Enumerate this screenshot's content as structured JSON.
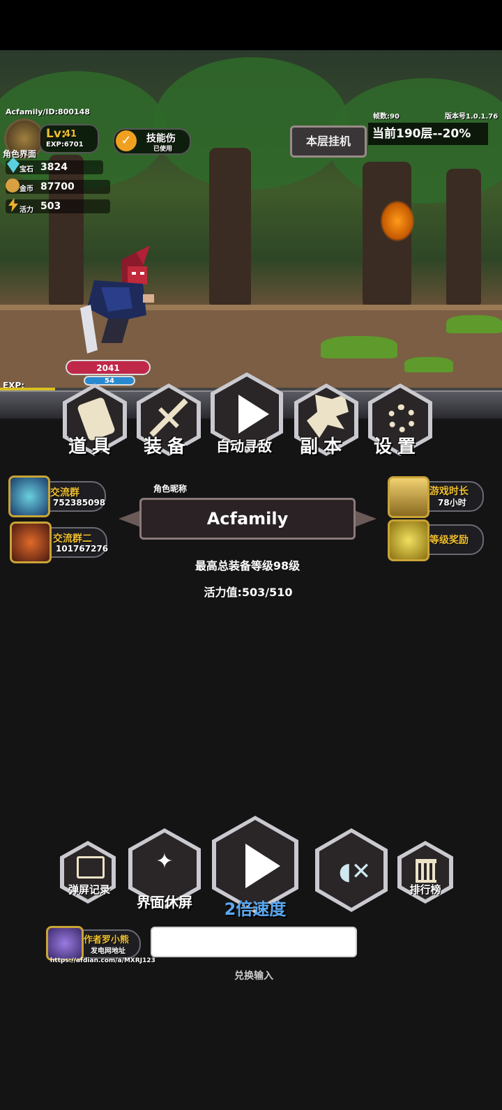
{
  "player": {
    "id_line": "Acfamily/ID:800148",
    "level_label": "Lv:",
    "level": "41",
    "exp_label": "EXP:6701",
    "role_screen": "角色界面",
    "skill_label": "技能伤",
    "skill_sub": "已使用"
  },
  "stats": {
    "gem_label": "宝石",
    "gem_value": "3824",
    "gold_label": "金币",
    "gold_value": "87700",
    "energy_label": "活力",
    "energy_value": "503"
  },
  "hud": {
    "fps": "帧数:90",
    "version": "版本号1.0.1.76",
    "idle_button": "本层挂机",
    "floor_status": "当前190层--20%",
    "hero_hp": "2041",
    "hero_mp": "54",
    "exp_bar_label": "EXP:",
    "exp_progress": 0.11
  },
  "main_menu": [
    {
      "label": "道具",
      "icon": "scroll-icon"
    },
    {
      "label": "装备",
      "icon": "sword-icon"
    },
    {
      "label": "自动寻敌",
      "icon": "play-icon"
    },
    {
      "label": "副本",
      "icon": "dragon-icon"
    },
    {
      "label": "设置",
      "icon": "gear-icon"
    }
  ],
  "side_left": [
    {
      "title": "交流群",
      "number": "752385098"
    },
    {
      "title": "交流群二",
      "number": "101767276"
    }
  ],
  "side_right": [
    {
      "title": "游戏时长",
      "value": "78小时"
    },
    {
      "title": "等级奖励",
      "value": ""
    }
  ],
  "profile": {
    "nickname_label": "角色昵称",
    "nickname": "Acfamily",
    "max_equip": "最高总装备等级98级",
    "energy": "活力值:503/510"
  },
  "bottom_bar": {
    "danmaku": "弹屏记录",
    "rest": "界面休屏",
    "speed": "2倍速度",
    "ranking": "排行榜"
  },
  "author": {
    "title": "作者罗小熊",
    "sub": "发电网地址",
    "url": "https://afdian.com/a/MXRJ123"
  },
  "redeem": {
    "placeholder": "",
    "label": "兑换输入"
  },
  "colors": {
    "gold": "#f0c030",
    "hp_red": "#c0284a",
    "mp_blue": "#2a8ad0",
    "speed_blue": "#5aa8f0"
  }
}
